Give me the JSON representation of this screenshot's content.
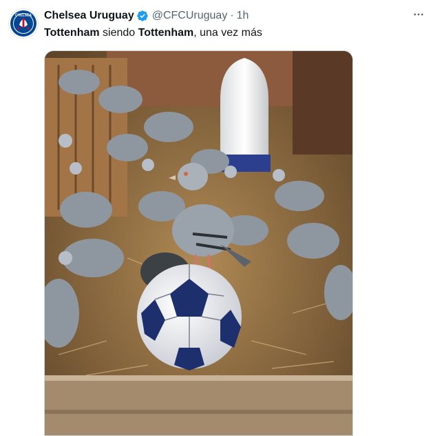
{
  "tweet": {
    "display_name": "Chelsea Uruguay",
    "handle": "@CFCUruguay",
    "separator": "·",
    "time": "1h",
    "text_parts": [
      {
        "text": "Tottenham",
        "bold": true
      },
      {
        "text": " siendo ",
        "bold": false
      },
      {
        "text": "Tottenham",
        "bold": true
      },
      {
        "text": ", una vez más",
        "bold": false
      }
    ]
  },
  "avatar": {
    "club_text": "CHELSEA"
  },
  "icons": {
    "verified": "verified-badge-icon",
    "more": "more-options-icon"
  },
  "colors": {
    "verified_blue": "#1d9bf0",
    "chelsea_blue": "#034694",
    "secondary_text": "#536471"
  },
  "media": {
    "subject": "pigeons on a football"
  }
}
